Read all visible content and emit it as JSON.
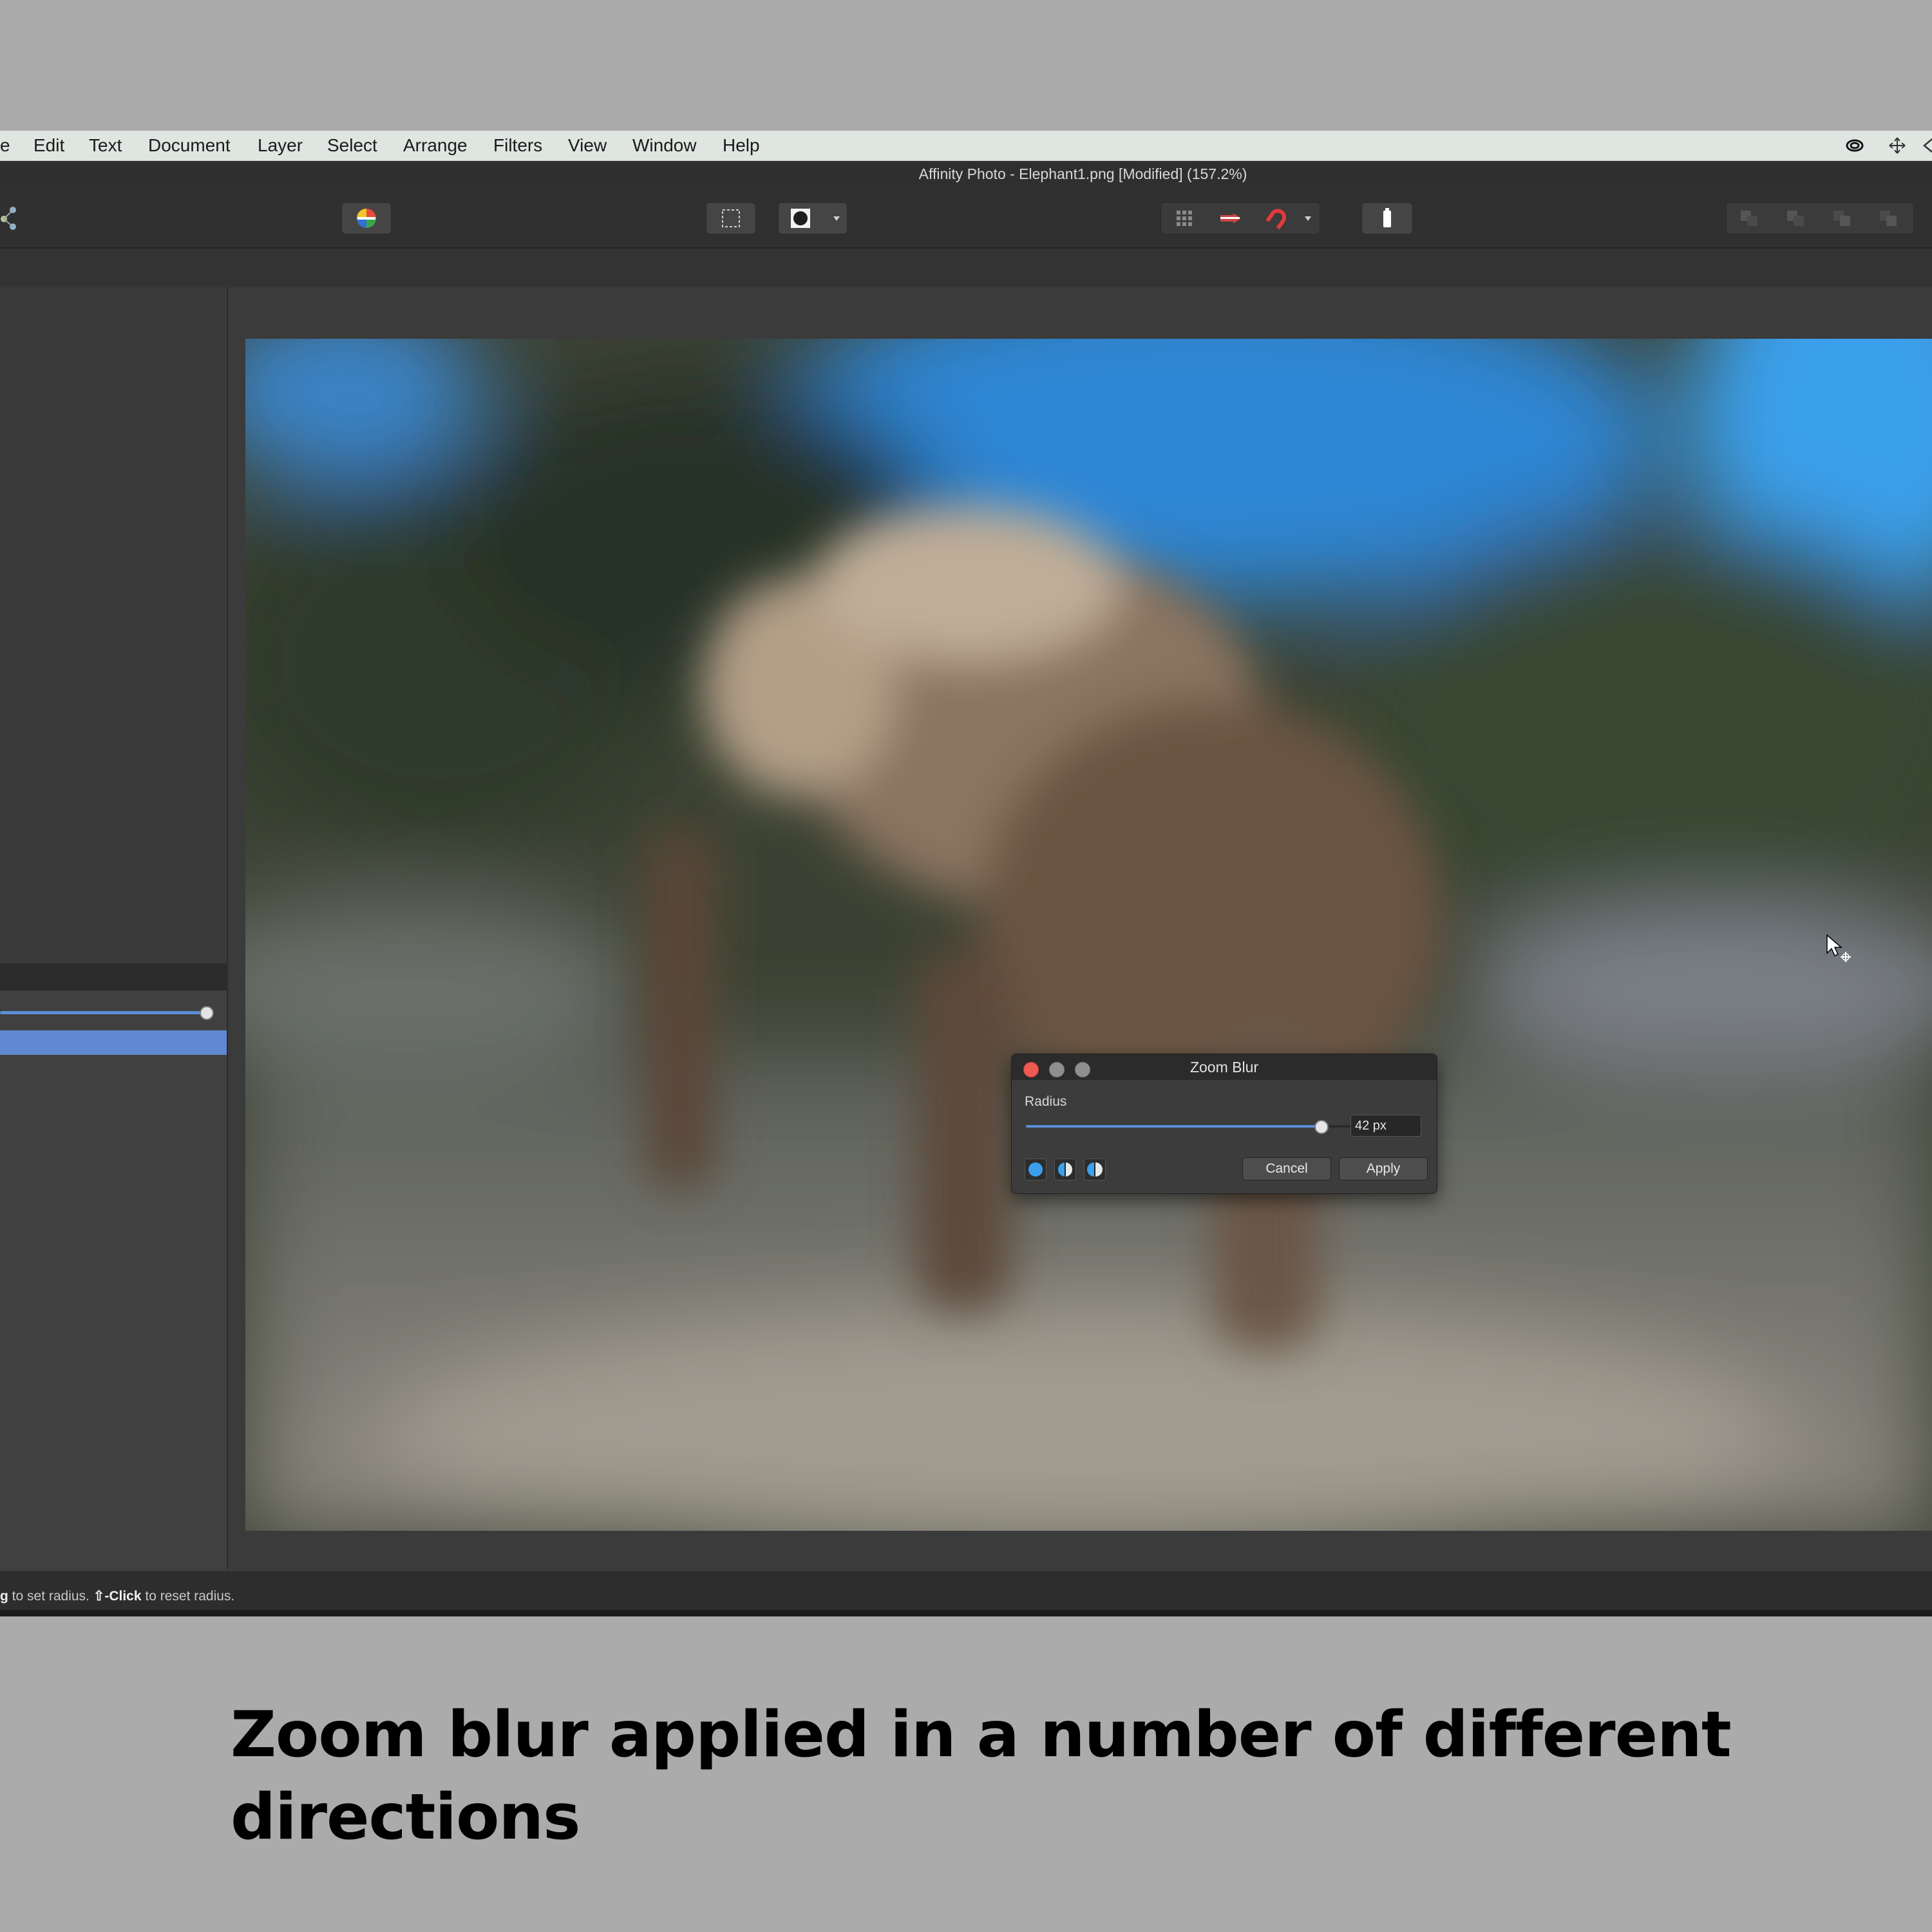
{
  "menubar": {
    "items": [
      "e",
      "Edit",
      "Text",
      "Document",
      "Layer",
      "Select",
      "Arrange",
      "Filters",
      "View",
      "Window",
      "Help"
    ],
    "system_icons": [
      "creative-cloud-icon",
      "move-icon",
      "back-icon"
    ]
  },
  "window": {
    "title": "Affinity Photo - Elephant1.png [Modified] (157.2%)"
  },
  "toolbar": {
    "icons": [
      "persona-icon",
      "color-wheel-icon",
      "marquee-icon",
      "mask-icon",
      "grid-icon",
      "snap-toggle-icon",
      "magnet-icon",
      "quickmask-icon",
      "arrange-icons"
    ]
  },
  "dialog": {
    "title": "Zoom Blur",
    "radius_label": "Radius",
    "radius_value": "42 px",
    "radius_fraction": 0.82,
    "cancel_label": "Cancel",
    "apply_label": "Apply",
    "mode_icons": [
      "full-effect-icon",
      "split-view-icon",
      "mirrored-view-icon"
    ]
  },
  "statusbar": {
    "part1": "g",
    "part2": " to set radius. ",
    "part3": "⇧-Click",
    "part4": " to reset radius."
  },
  "caption": "Zoom blur applied in a number of different directions",
  "colors": {
    "accent": "#5b8ed6",
    "close": "#ec5a52",
    "disabled_traffic": "#8f8f8f"
  }
}
